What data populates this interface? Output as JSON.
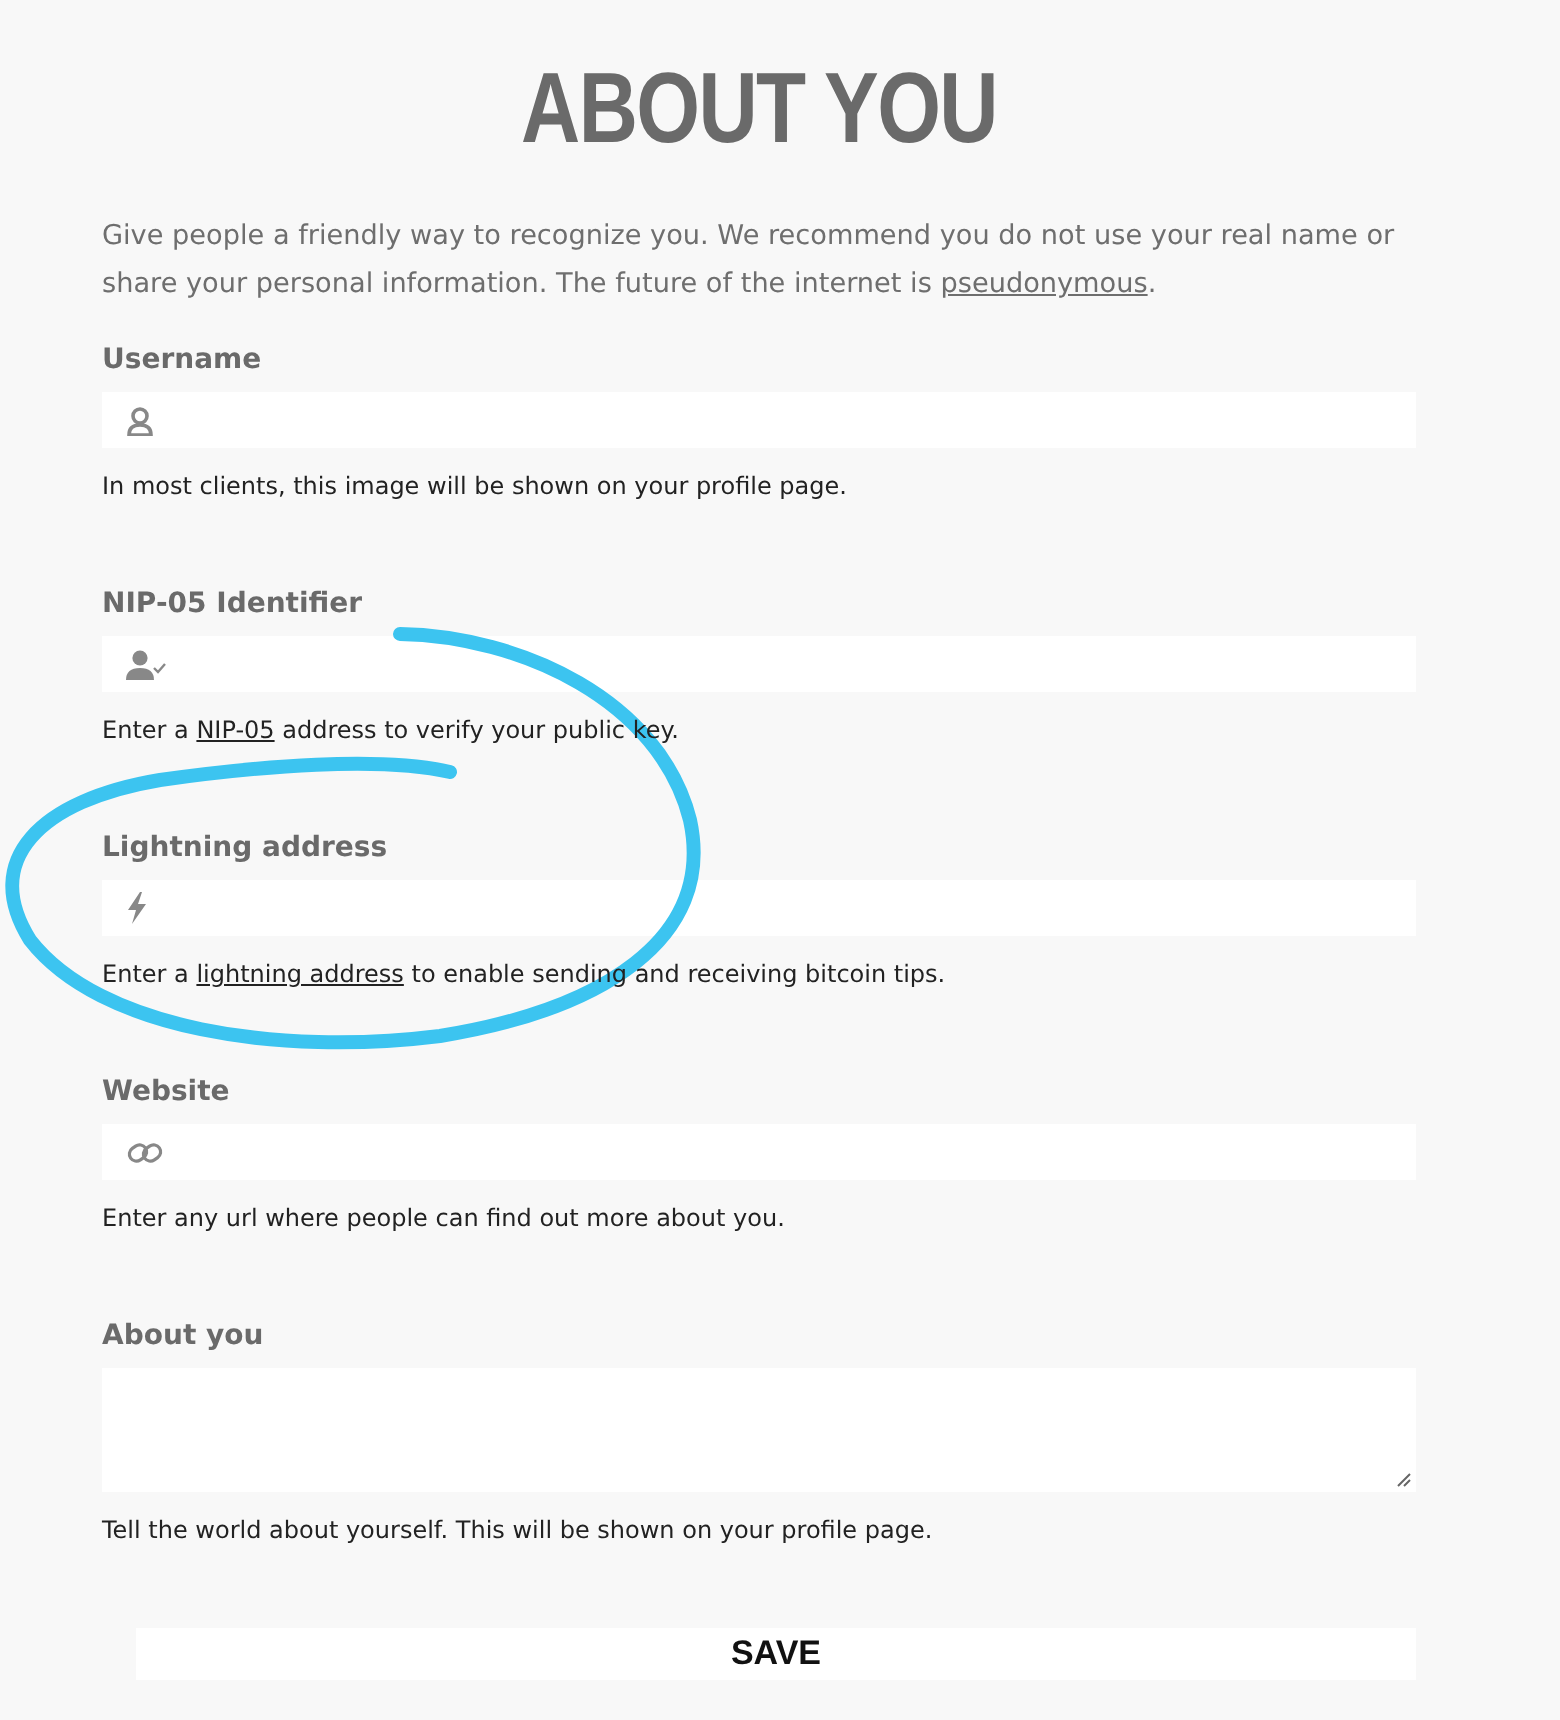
{
  "title": "ABOUT YOU",
  "intro": {
    "text_before": "Give people a friendly way to recognize you. We recommend you do not use your real name or share your personal information. The future of the internet is ",
    "link": "pseudonymous",
    "text_after": "."
  },
  "fields": [
    {
      "kind": "input",
      "label": "Username",
      "help": {
        "text_before": "In most clients, this image will be shown on your profile page."
      }
    },
    {
      "kind": "input",
      "label": "NIP-05 Identifier",
      "help": {
        "text_before": "Enter a ",
        "link": "NIP-05",
        "text_after": " address to verify your public key."
      }
    },
    {
      "kind": "input",
      "label": "Lightning address",
      "help": {
        "text_before": "Enter a ",
        "link": "lightning address",
        "text_after": " to enable sending and receiving bitcoin tips."
      }
    },
    {
      "kind": "input",
      "label": "Website",
      "help": {
        "text_before": "Enter any url where people can find out more about you."
      }
    },
    {
      "kind": "textarea",
      "label": "About you",
      "help": {
        "text_before": "Tell the world about yourself. This will be shown on your profile page."
      }
    }
  ],
  "save_button": "SAVE"
}
